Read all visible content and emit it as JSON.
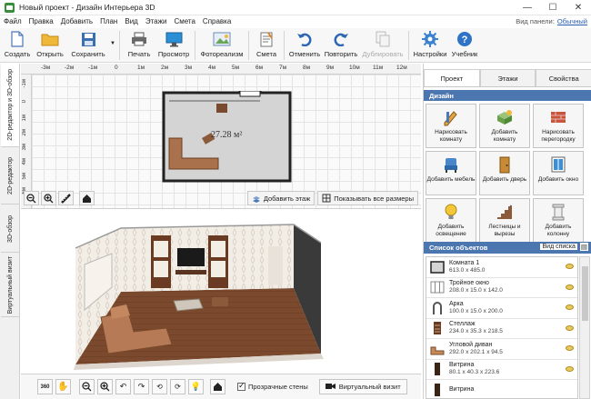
{
  "window": {
    "title": "Новый проект - Дизайн Интерьера 3D",
    "controls": [
      "—",
      "☐",
      "✕"
    ]
  },
  "menu": [
    "Файл",
    "Правка",
    "Добавить",
    "План",
    "Вид",
    "Этажи",
    "Смета",
    "Справка"
  ],
  "panel_view": {
    "label": "Вид панели:",
    "value": "Обычный"
  },
  "toolbar": {
    "create": "Создать",
    "open": "Открыть",
    "save": "Сохранить",
    "print": "Печать",
    "preview": "Просмотр",
    "photo": "Фотореализм",
    "estimate": "Смета",
    "undo": "Отменить",
    "redo": "Повторить",
    "duplicate": "Дублировать",
    "settings": "Настройки",
    "tutorial": "Учебник"
  },
  "left_tabs": [
    "2D-редактор и 3D-обзор",
    "2D-редактор",
    "3D-обзор",
    "Виртуальный визит"
  ],
  "editor2d": {
    "ruler_top": [
      "-3м",
      "-2м",
      "-1м",
      "0",
      "1м",
      "2м",
      "3м",
      "4м",
      "5м",
      "6м",
      "7м",
      "8м",
      "9м",
      "10м",
      "11м",
      "12м"
    ],
    "ruler_left": [
      "-1м",
      "0",
      "1м",
      "2м",
      "3м",
      "4м",
      "5м",
      "6м"
    ],
    "room_area": "27.28 м²",
    "add_floor": "Добавить этаж",
    "show_sizes": "Показывать все размеры"
  },
  "bottombar": {
    "transparent_walls": "Прозрачные стены",
    "virtual_visit": "Виртуальный визит",
    "rotate_360": "360"
  },
  "rpanel": {
    "tabs": [
      "Проект",
      "Этажи",
      "Свойства"
    ],
    "design_header": "Дизайн",
    "design_buttons": [
      {
        "label": "Нарисовать комнату",
        "icon": "draw-room-icon"
      },
      {
        "label": "Добавить комнату",
        "icon": "add-room-icon"
      },
      {
        "label": "Нарисовать перегородку",
        "icon": "draw-partition-icon"
      },
      {
        "label": "Добавить мебель",
        "icon": "add-furniture-icon"
      },
      {
        "label": "Добавить дверь",
        "icon": "add-door-icon"
      },
      {
        "label": "Добавить окно",
        "icon": "add-window-icon"
      },
      {
        "label": "Добавить освещение",
        "icon": "add-lighting-icon"
      },
      {
        "label": "Лестницы и вырезы",
        "icon": "stairs-icon"
      },
      {
        "label": "Добавить колонну",
        "icon": "add-column-icon"
      }
    ],
    "objlist_header": "Список объектов",
    "objlist_view": "Вид списка",
    "objects": [
      {
        "name": "Комната 1",
        "size": "613.0 x 485.0"
      },
      {
        "name": "Тройное окно",
        "size": "208.0 x 15.0 x 142.0"
      },
      {
        "name": "Арка",
        "size": "100.0 x 15.0 x 200.0"
      },
      {
        "name": "Стеллаж",
        "size": "234.0 x 35.3 x 218.5"
      },
      {
        "name": "Угловой диван",
        "size": "292.0 x 202.1 x 94.5"
      },
      {
        "name": "Витрина",
        "size": "80.1 x 40.3 x 223.6"
      },
      {
        "name": "Витрина",
        "size": ""
      }
    ]
  },
  "colors": {
    "accent": "#4c76b0",
    "floor": "#7a4a30",
    "wall": "#f1ece4",
    "wall_pattern": "#c9c0b4",
    "sofa": "#b77a56",
    "room2d_fill": "#d6d6d6"
  }
}
